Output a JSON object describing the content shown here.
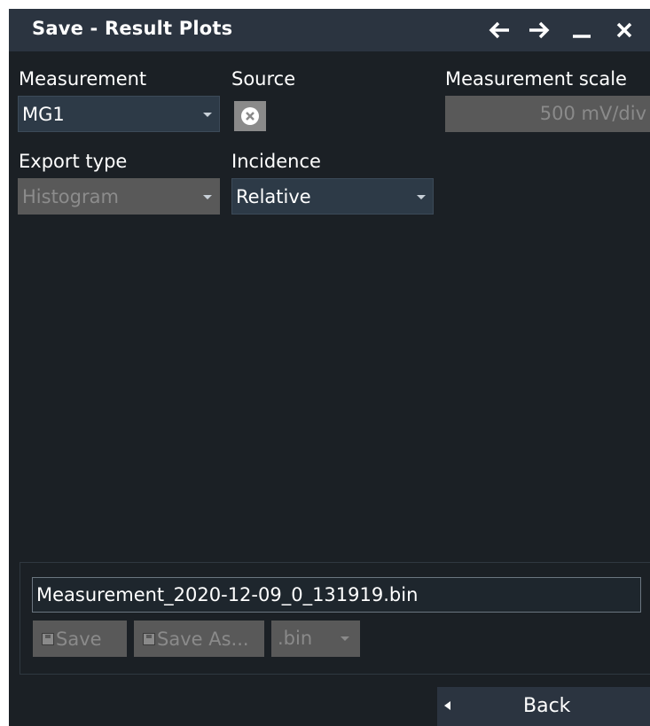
{
  "dialog": {
    "title": "Save - Result Plots",
    "icons": [
      "arrow-left-icon",
      "arrow-right-icon",
      "minimize-icon",
      "close-icon"
    ]
  },
  "measurement": {
    "label": "Measurement",
    "value": "MG1"
  },
  "source": {
    "label": "Source",
    "icon": "clear-icon"
  },
  "measurement_scale": {
    "label": "Measurement scale",
    "value": "500 mV/div"
  },
  "export_type": {
    "label": "Export type",
    "value": "Histogram"
  },
  "incidence": {
    "label": "Incidence",
    "value": "Relative"
  },
  "file": {
    "name": "Measurement_2020-12-09_0_131919.bin",
    "save_label": "Save",
    "save_as_label": "Save As...",
    "extension": ".bin"
  },
  "back_label": "Back",
  "colors": {
    "background": "#1b2025",
    "titlebar": "#2b3440",
    "dropdown": "#2d3a47",
    "disabled": "#595959",
    "disabled_text": "#8a8a8a"
  }
}
